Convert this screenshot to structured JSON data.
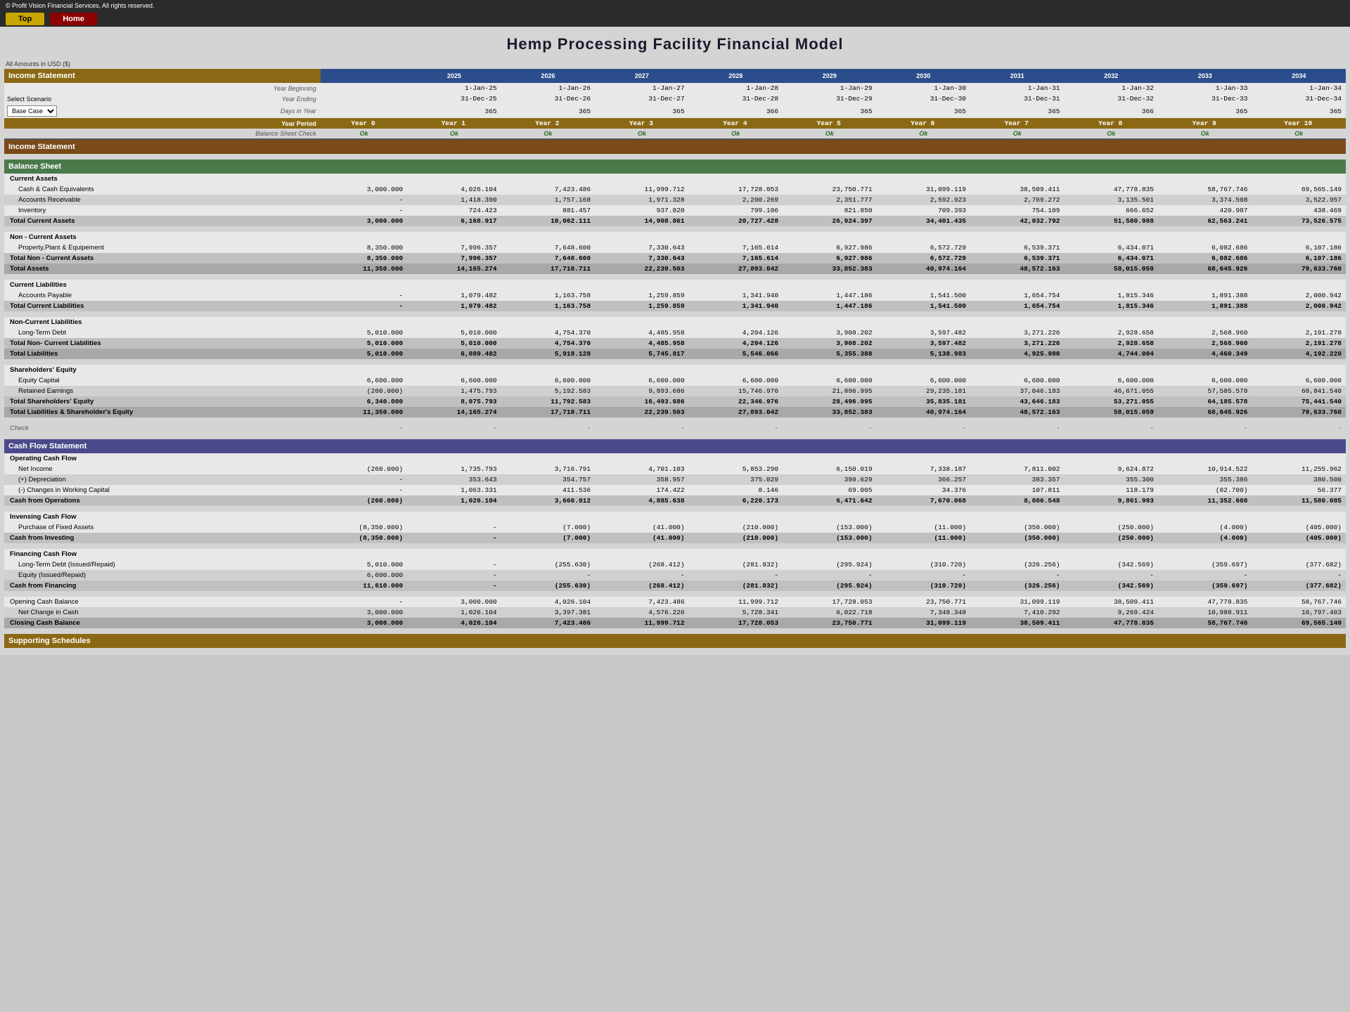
{
  "header": {
    "logo": "© Profit Vision Financial Services, All rights reserved.",
    "top_button": "Top",
    "home_button": "Home",
    "title": "Hemp Processing Facility Financial Model",
    "currency_note": "All Amounts in  USD ($)"
  },
  "columns": {
    "years": [
      "2025",
      "2026",
      "2027",
      "2028",
      "2029",
      "2030",
      "2031",
      "2032",
      "2033",
      "2034"
    ],
    "year_beginning": [
      "1-Jan-25",
      "1-Jan-26",
      "1-Jan-27",
      "1-Jan-28",
      "1-Jan-29",
      "1-Jan-30",
      "1-Jan-31",
      "1-Jan-32",
      "1-Jan-33",
      "1-Jan-34"
    ],
    "year_ending": [
      "31-Dec-25",
      "31-Dec-26",
      "31-Dec-27",
      "31-Dec-28",
      "31-Dec-29",
      "31-Dec-30",
      "31-Dec-31",
      "31-Dec-32",
      "31-Dec-33",
      "31-Dec-34"
    ],
    "days": [
      "365",
      "365",
      "365",
      "366",
      "365",
      "365",
      "365",
      "366",
      "365",
      "365"
    ],
    "year_period": [
      "Year 0",
      "Year 1",
      "Year 2",
      "Year 3",
      "Year 4",
      "Year 5",
      "Year 6",
      "Year 7",
      "Year 8",
      "Year 9",
      "Year 10"
    ],
    "balance_check": [
      "Ok",
      "Ok",
      "Ok",
      "Ok",
      "Ok",
      "Ok",
      "Ok",
      "Ok",
      "Ok",
      "Ok",
      "Ok"
    ]
  },
  "scenario": {
    "label": "Select Scenario",
    "value": "Base Case"
  },
  "income_statement": {
    "section_label": "Income Statement"
  },
  "balance_sheet": {
    "section_label": "Balance Sheet",
    "current_assets_label": "Current Assets",
    "cash": {
      "label": "Cash & Cash Equivalents",
      "y0": "3,000.000",
      "vals": [
        "4,026.104",
        "7,423.486",
        "11,999.712",
        "17,728.053",
        "23,750.771",
        "31,099.119",
        "38,509.411",
        "47,778.835",
        "58,767.746",
        "69,565.149"
      ]
    },
    "ar": {
      "label": "Accounts Receivable",
      "y0": "-",
      "vals": [
        "1,418.390",
        "1,757.168",
        "1,971.328",
        "2,200.269",
        "2,351.777",
        "2,592.923",
        "2,769.272",
        "3,135.501",
        "3,374.508",
        "3,522.957"
      ]
    },
    "inventory": {
      "label": "Inventory",
      "y0": "-",
      "vals": [
        "724.423",
        "881.457",
        "937.820",
        "799.106",
        "821.850",
        "709.393",
        "754.109",
        "666.652",
        "420.987",
        "438.469"
      ]
    },
    "total_current_assets": {
      "label": "Total Current Assets",
      "y0": "3,000.000",
      "vals": [
        "6,168.917",
        "10,062.111",
        "14,908.861",
        "20,727.428",
        "26,924.397",
        "34,401.435",
        "42,032.792",
        "51,580.988",
        "62,563.241",
        "73,526.575"
      ]
    },
    "non_current_label": "Non - Current Assets",
    "ppe": {
      "label": "Property,Plant & Equipement",
      "y0": "8,350.000",
      "vals": [
        "7,996.357",
        "7,648.600",
        "7,330.643",
        "7,165.614",
        "6,927.986",
        "6,572.729",
        "6,539.371",
        "6,434.071",
        "6,082.686",
        "6,107.186"
      ]
    },
    "total_non_current": {
      "label": "Total Non - Current Assets",
      "y0": "8,350.000",
      "vals": [
        "7,996.357",
        "7,648.600",
        "7,330.643",
        "7,165.614",
        "6,927.986",
        "6,572.729",
        "6,539.371",
        "6,434.071",
        "6,082.686",
        "6,107.186"
      ]
    },
    "total_assets": {
      "label": "Total Assets",
      "y0": "11,350.000",
      "vals": [
        "14,165.274",
        "17,710.711",
        "22,239.503",
        "27,893.042",
        "33,852.383",
        "40,974.164",
        "48,572.163",
        "58,015.059",
        "68,645.926",
        "79,633.760"
      ]
    },
    "current_liabilities_label": "Current Liabilities",
    "ap": {
      "label": "Accounts Payable",
      "y0": "-",
      "vals": [
        "1,079.482",
        "1,163.758",
        "1,259.859",
        "1,341.940",
        "1,447.186",
        "1,541.500",
        "1,654.754",
        "1,815.346",
        "1,891.388",
        "2,000.942"
      ]
    },
    "total_current_liabilities": {
      "label": "Total Current Liabilities",
      "y0": "-",
      "vals": [
        "1,079.482",
        "1,163.758",
        "1,259.859",
        "1,341.940",
        "1,447.186",
        "1,541.500",
        "1,654.754",
        "1,815.346",
        "1,891.388",
        "2,000.942"
      ]
    },
    "non_current_liabilities_label": "Non-Current Liabilities",
    "ltd": {
      "label": "Long-Term Debt",
      "y0": "5,010.000",
      "vals": [
        "5,010.000",
        "4,754.370",
        "4,485.958",
        "4,204.126",
        "3,908.202",
        "3,597.482",
        "3,271.226",
        "2,928.658",
        "2,568.960",
        "2,191.278"
      ]
    },
    "total_non_current_liabilities": {
      "label": "Total Non- Current Liabilities",
      "y0": "5,010.000",
      "vals": [
        "5,010.000",
        "4,754.370",
        "4,485.958",
        "4,204.126",
        "3,908.202",
        "3,597.482",
        "3,271.226",
        "2,928.658",
        "2,568.960",
        "2,191.278"
      ]
    },
    "total_liabilities": {
      "label": "Total Liabilities",
      "y0": "5,010.000",
      "vals": [
        "6,089.482",
        "5,918.128",
        "5,745.817",
        "5,546.066",
        "5,355.388",
        "5,138.983",
        "4,925.980",
        "4,744.004",
        "4,460.349",
        "4,192.220"
      ]
    },
    "equity_label": "Shareholders' Equity",
    "equity_capital": {
      "label": "Equity Capital",
      "y0": "6,600.000",
      "vals": [
        "6,600.000",
        "6,600.000",
        "6,600.000",
        "6,600.000",
        "6,600.000",
        "6,600.000",
        "6,600.000",
        "6,600.000",
        "6,600.000",
        "6,600.000"
      ]
    },
    "retained_earnings": {
      "label": "Retained Earnings",
      "y0": "(260.000)",
      "vals": [
        "1,475.793",
        "5,192.583",
        "9,893.686",
        "15,746.976",
        "21,896.995",
        "29,235.181",
        "37,046.183",
        "46,671.055",
        "57,585.578",
        "68,841.540"
      ]
    },
    "total_equity": {
      "label": "Total Shareholders' Equity",
      "y0": "6,340.000",
      "vals": [
        "8,075.793",
        "11,792.583",
        "16,493.686",
        "22,346.976",
        "28,496.995",
        "35,835.181",
        "43,646.183",
        "53,271.055",
        "64,185.578",
        "75,441.540"
      ]
    },
    "total_liabilities_equity": {
      "label": "Total Liabilities & Shareholder's Equity",
      "y0": "11,350.000",
      "vals": [
        "14,165.274",
        "17,710.711",
        "22,239.503",
        "27,893.042",
        "33,852.383",
        "40,974.164",
        "48,572.163",
        "58,015.059",
        "68,645.926",
        "79,633.760"
      ]
    },
    "check": {
      "label": "Check",
      "y0": "-",
      "vals": [
        "-",
        "-",
        "-",
        "-",
        "-",
        "-",
        "-",
        "-",
        "-",
        "-"
      ]
    }
  },
  "cash_flow": {
    "section_label": "Cash Flow Statement",
    "operating_label": "Operating Cash Flow",
    "net_income": {
      "label": "Net Income",
      "y0": "(260.000)",
      "vals": [
        "1,735.793",
        "3,716.791",
        "4,701.103",
        "5,853.290",
        "6,150.019",
        "7,338.187",
        "7,811.002",
        "9,624.872",
        "10,914.522",
        "11,255.962"
      ]
    },
    "depreciation": {
      "label": "(+) Depreciation",
      "y0": "-",
      "vals": [
        "353.643",
        "354.757",
        "358.957",
        "375.029",
        "390.629",
        "366.257",
        "383.357",
        "355.300",
        "355.386",
        "380.500"
      ]
    },
    "working_capital": {
      "label": "(-) Changes in Working Capital",
      "y0": "-",
      "vals": [
        "1,063.331",
        "411.536",
        "174.422",
        "8.146",
        "69.005",
        "34.376",
        "107.811",
        "118.179",
        "(82.700)",
        "56.377"
      ]
    },
    "cash_operations": {
      "label": "Cash from Operations",
      "y0": "(260.000)",
      "vals": [
        "1,026.104",
        "3,660.012",
        "4,885.638",
        "6,220.173",
        "6,471.642",
        "7,670.068",
        "8,086.548",
        "9,861.993",
        "11,352.608",
        "11,580.085"
      ]
    },
    "investing_label": "Invensing Cash Flow",
    "fixed_assets": {
      "label": "Purchase of Fixed Assets",
      "y0": "(8,350.000)",
      "vals": [
        "-",
        "(7.000)",
        "(41.000)",
        "(210.000)",
        "(153.000)",
        "(11.000)",
        "(350.000)",
        "(250.000)",
        "(4.000)",
        "(405.000)"
      ]
    },
    "cash_investing": {
      "label": "Cash from Investing",
      "y0": "(8,350.000)",
      "vals": [
        "-",
        "(7.000)",
        "(41.000)",
        "(210.000)",
        "(153.000)",
        "(11.000)",
        "(350.000)",
        "(250.000)",
        "(4.000)",
        "(405.000)"
      ]
    },
    "financing_label": "Financing Cash Flow",
    "ltd_issued": {
      "label": "Long-Term Debt (Issued/Repaid)",
      "y0": "5,010.000",
      "vals": [
        "-",
        "(255.630)",
        "(268.412)",
        "(281.832)",
        "(295.924)",
        "(310.720)",
        "(326.256)",
        "(342.569)",
        "(359.697)",
        "(377.682)"
      ]
    },
    "equity_issued": {
      "label": "Equity (Issued/Repaid)",
      "y0": "6,600.000",
      "vals": [
        "-",
        "-",
        "-",
        "-",
        "-",
        "-",
        "-",
        "-",
        "-",
        "-"
      ]
    },
    "cash_financing": {
      "label": "Cash from Financing",
      "y0": "11,610.000",
      "vals": [
        "-",
        "(255.630)",
        "(268.412)",
        "(281.832)",
        "(295.924)",
        "(310.720)",
        "(326.256)",
        "(342.569)",
        "(359.697)",
        "(377.682)"
      ]
    },
    "opening_cash": {
      "label": "Opening Cash Balance",
      "y0": "-",
      "vals": [
        "3,000.000",
        "4,026.104",
        "7,423.486",
        "11,999.712",
        "17,728.053",
        "23,750.771",
        "31,099.119",
        "38,509.411",
        "47,778.835",
        "58,767.746"
      ]
    },
    "net_change": {
      "label": "Net Change in Cash",
      "y0": "3,000.000",
      "vals": [
        "1,026.104",
        "3,397.381",
        "4,576.226",
        "5,728.341",
        "6,022.718",
        "7,348.348",
        "7,410.292",
        "9,269.424",
        "10,988.911",
        "10,797.403"
      ]
    },
    "closing_cash": {
      "label": "Closing Cash Balance",
      "y0": "3,000.000",
      "vals": [
        "4,026.104",
        "7,423.486",
        "11,999.712",
        "17,728.053",
        "23,750.771",
        "31,099.119",
        "38,509.411",
        "47,778.835",
        "58,767.746",
        "69,565.149"
      ]
    }
  },
  "supporting": {
    "section_label": "Supporting Schedules"
  }
}
